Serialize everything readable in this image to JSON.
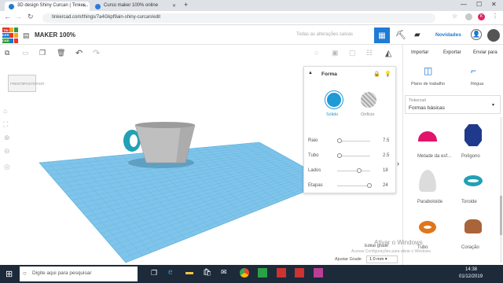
{
  "browser": {
    "tabs": [
      {
        "label": "3D design Shiny Curcan | Tinker...",
        "icon_color": "#1e7bd3"
      },
      {
        "label": "Curso maker 100% online",
        "icon_color": "#2a7be4"
      }
    ],
    "url": "tinkercad.com/things/7a4Gkpf9ain-shiny-curcan/edit"
  },
  "app": {
    "logo_letters": [
      "TIN",
      "KER",
      "CAD"
    ],
    "logo_colors": [
      "#e4362b",
      "#f6a623",
      "#2f9a3f",
      "#1477d4",
      "#e4362b",
      "#f6a623",
      "#2f9a3f",
      "#1477d4",
      "#e4362b"
    ],
    "title": "MAKER 100%",
    "save_status": "Todas as alterações salvas",
    "novidades": "Novidades",
    "import": "Importar",
    "export": "Exportar",
    "send": "Enviar para"
  },
  "viewcube": {
    "top": "TOP",
    "left": "FRENTE",
    "right": "POSTERIOR"
  },
  "shape_panel": {
    "title": "Forma",
    "solid": "Sólido",
    "hole": "Orifício",
    "params": [
      {
        "label": "Raio",
        "value": "7.5",
        "fraction": 0.0
      },
      {
        "label": "Tubo",
        "value": "2.5",
        "fraction": 0.0
      },
      {
        "label": "Lados",
        "value": "18",
        "fraction": 0.65
      },
      {
        "label": "Etapas",
        "value": "24",
        "fraction": 1.0
      }
    ]
  },
  "right": {
    "workplane": "Plano de trabalho",
    "ruler": "Régua",
    "library_label": "Tinkercad",
    "library": "Formas básicas",
    "shapes": [
      {
        "label": "Metade da esf...",
        "color": "#e3126b"
      },
      {
        "label": "Polígono",
        "color": "#1f3a8c"
      },
      {
        "label": "Paraboloide",
        "color": "#dcdcdc"
      },
      {
        "label": "Toroide",
        "color": "#22a0b6"
      },
      {
        "label": "Tubo",
        "color": "#e0761c"
      },
      {
        "label": "Coração",
        "color": "#a9643a"
      }
    ]
  },
  "bottom": {
    "edit_grid": "Editar grade",
    "snap_label": "Ajustar Grade",
    "snap_value": "1.0 mm"
  },
  "watermark": {
    "title": "Ativar o Windows",
    "subtitle": "Acesse Configurações para ativar o Windows."
  },
  "taskbar": {
    "search": "Digite aqui para pesquisar",
    "time": "14:38",
    "date": "01/12/2019"
  }
}
